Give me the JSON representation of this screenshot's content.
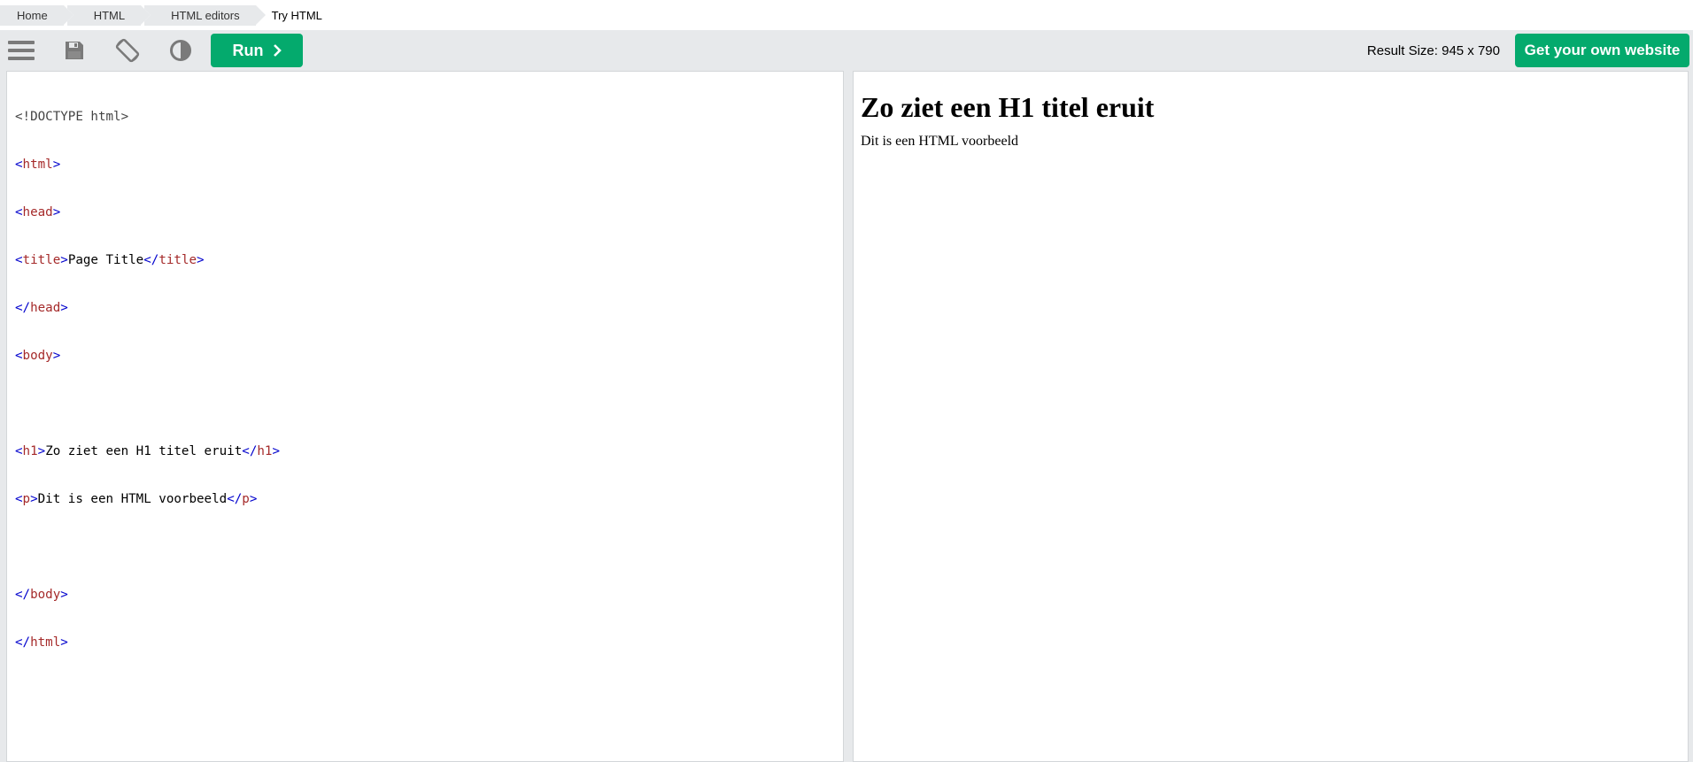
{
  "breadcrumb": {
    "items": [
      {
        "label": "Home"
      },
      {
        "label": "HTML"
      },
      {
        "label": "HTML editors"
      },
      {
        "label": "Try HTML"
      }
    ]
  },
  "toolbar": {
    "run_label": "Run",
    "result_size": "Result Size: 945 x 790",
    "own_website_label": "Get your own website",
    "accent": "#04aa6d",
    "icons": [
      "menu-icon",
      "save-icon",
      "rotate-icon",
      "contrast-icon",
      "chevron-right-icon"
    ]
  },
  "code": {
    "lines": {
      "l1": {
        "text": "<!DOCTYPE html>"
      },
      "l2": {
        "open": "<",
        "name": "html",
        "close": ">"
      },
      "l3": {
        "open": "<",
        "name": "head",
        "close": ">"
      },
      "l4": {
        "open": "<",
        "name": "title",
        "close": ">",
        "content": "Page Title",
        "end_open": "</",
        "end_name": "title",
        "end_close": ">"
      },
      "l5": {
        "open": "</",
        "name": "head",
        "close": ">"
      },
      "l6": {
        "open": "<",
        "name": "body",
        "close": ">"
      },
      "l8": {
        "open": "<",
        "name": "h1",
        "close": ">",
        "content": "Zo ziet een H1 titel eruit",
        "end_open": "</",
        "end_name": "h1",
        "end_close": ">"
      },
      "l9": {
        "open": "<",
        "name": "p",
        "close": ">",
        "content": "Dit is een HTML voorbeeld",
        "end_open": "</",
        "end_name": "p",
        "end_close": ">"
      },
      "l11": {
        "open": "</",
        "name": "body",
        "close": ">"
      },
      "l12": {
        "open": "</",
        "name": "html",
        "close": ">"
      }
    }
  },
  "result": {
    "heading": "Zo ziet een H1 titel eruit",
    "paragraph": "Dit is een HTML voorbeeld"
  }
}
